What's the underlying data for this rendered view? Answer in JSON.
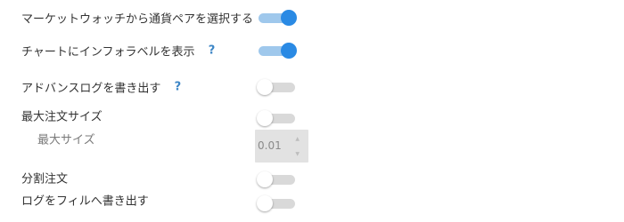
{
  "settings": {
    "market_watch": {
      "label": "マーケットウォッチから通貨ペアを選択する",
      "enabled": true
    },
    "chart_info_label": {
      "label": "チャートにインフォラベルを表示",
      "help": "?",
      "enabled": true
    },
    "export_advanced_logs": {
      "label": "アドバンスログを書き出す",
      "help": "?",
      "enabled": false
    },
    "max_order_size": {
      "label": "最大注文サイズ",
      "enabled": false
    },
    "max_size": {
      "label": "最大サイズ",
      "value": "0.01"
    },
    "split_order": {
      "label": "分割注文",
      "enabled": false
    },
    "export_logs_to_file": {
      "label": "ログをフィルへ書き出す",
      "enabled": false
    }
  },
  "colors": {
    "toggle_on_knob": "#2a8ae4",
    "toggle_on_track": "#9fc8ec",
    "toggle_off_track": "#d9d9d9",
    "help_icon": "#3d86c6"
  },
  "icons": {
    "help": "question-mark-icon",
    "stepper_up": "chevron-up-icon",
    "stepper_down": "chevron-down-icon"
  }
}
